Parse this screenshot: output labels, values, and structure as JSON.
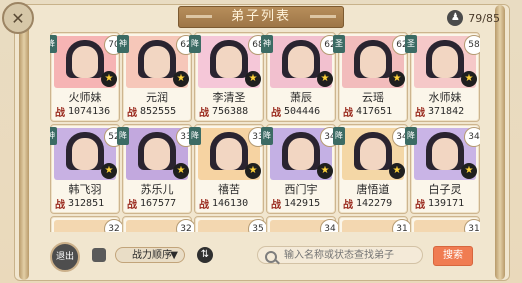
{
  "header": {
    "title": "弟子列表",
    "count_text": "79/85"
  },
  "bottom": {
    "exit_label": "退出",
    "sort_label": "战力顺序",
    "search_placeholder": "输入名称或状态查找弟子",
    "search_button": "搜索"
  },
  "card_power_label": "战",
  "disciples": [
    {
      "name": "火师妹",
      "power": "1074136",
      "level": "70",
      "tag": "降",
      "bg": "#f6b4b4"
    },
    {
      "name": "元润",
      "power": "852555",
      "level": "62",
      "tag": "神",
      "bg": "#f6c7b9"
    },
    {
      "name": "李清圣",
      "power": "756388",
      "level": "68",
      "tag": "降",
      "bg": "#f5c7d8"
    },
    {
      "name": "萧辰",
      "power": "504446",
      "level": "62",
      "tag": "神",
      "bg": "#f2c0cf"
    },
    {
      "name": "云瑶",
      "power": "417651",
      "level": "62",
      "tag": "圣",
      "bg": "#f2bcbc"
    },
    {
      "name": "水师妹",
      "power": "371842",
      "level": "58",
      "tag": "圣",
      "bg": "#f5c8c8"
    },
    {
      "name": "韩飞羽",
      "power": "312851",
      "level": "52",
      "tag": "神",
      "bg": "#c8b1e3"
    },
    {
      "name": "苏乐儿",
      "power": "167577",
      "level": "33",
      "tag": "降",
      "bg": "#c2a8de"
    },
    {
      "name": "禧苦",
      "power": "146130",
      "level": "33",
      "tag": "降",
      "bg": "#f6d3a2"
    },
    {
      "name": "西门宇",
      "power": "142915",
      "level": "34",
      "tag": "降",
      "bg": "#c4b0e4"
    },
    {
      "name": "唐悟道",
      "power": "142279",
      "level": "34",
      "tag": "降",
      "bg": "#f4d7a6"
    },
    {
      "name": "白子灵",
      "power": "139171",
      "level": "34",
      "tag": "降",
      "bg": "#c9b4e6"
    }
  ],
  "next_row_levels": [
    "32",
    "32",
    "35",
    "34",
    "31",
    "31"
  ]
}
